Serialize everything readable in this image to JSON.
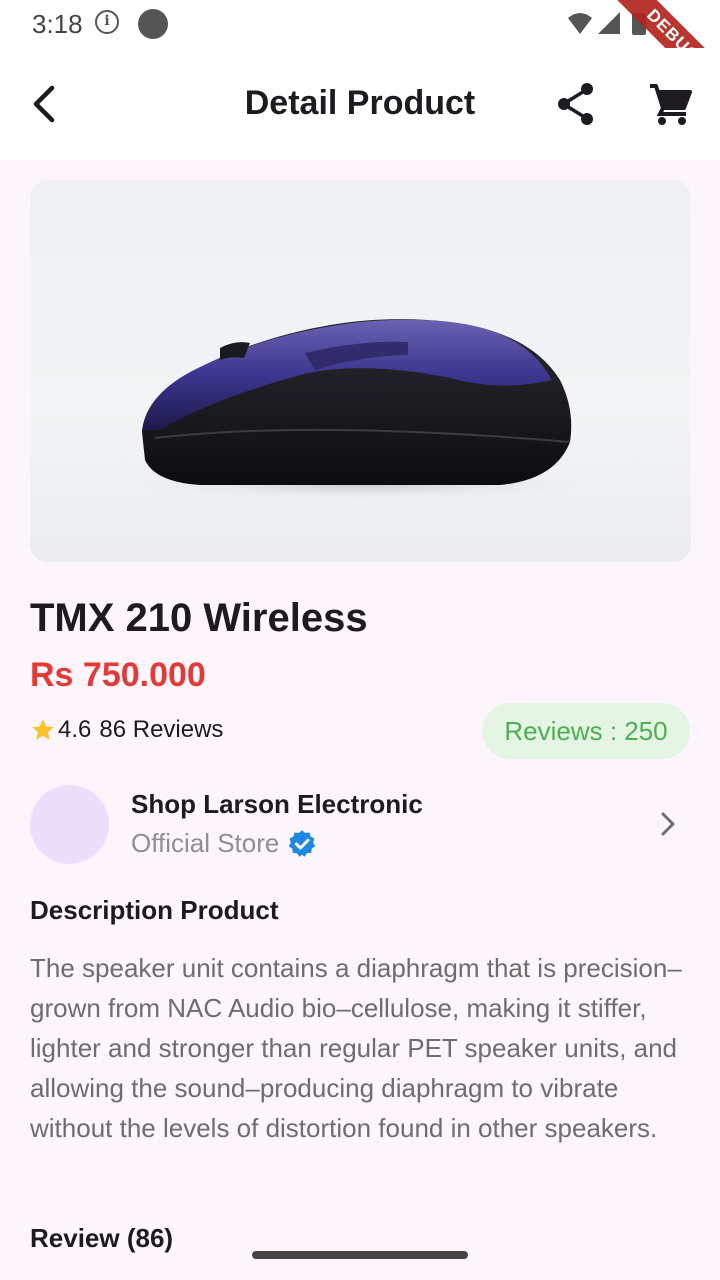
{
  "status_bar": {
    "time": "3:18",
    "debug_label": "DEBUG"
  },
  "app_bar": {
    "title": "Detail Product",
    "back_icon": "arrow-back-icon",
    "share_icon": "share-icon",
    "cart_icon": "shopping-cart-icon"
  },
  "product": {
    "name": "TMX 210 Wireless",
    "price": "Rs 750.000",
    "rating": "4.6",
    "reviews_text": "86 Reviews",
    "reviews_badge": "Reviews : 250"
  },
  "shop": {
    "name": "Shop Larson Electronic",
    "type": "Official Store"
  },
  "description": {
    "heading": "Description Product",
    "text": "The speaker unit contains a diaphragm that is precision–grown from NAC Audio bio–cellulose, making it stiffer, lighter and stronger than regular PET speaker units, and allowing the sound–producing diaphragm to vibrate without the levels of distortion found in other speakers."
  },
  "review": {
    "heading": "Review (86)"
  },
  "colors": {
    "background": "#fcf6fc",
    "price": "#e53935",
    "badge_bg": "#e5f5e4",
    "badge_text": "#4caf50",
    "star": "#fbc02d",
    "verified": "#1e88e5",
    "avatar": "#ebe0fc",
    "debug_banner": "#b3261e"
  }
}
